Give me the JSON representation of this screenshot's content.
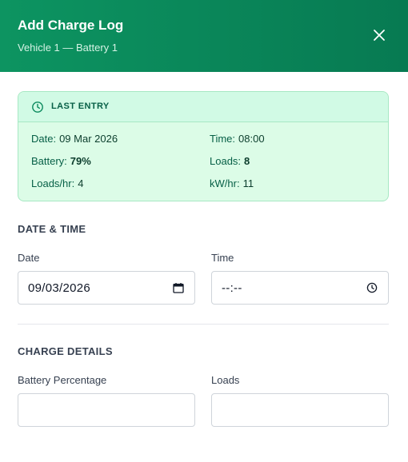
{
  "header": {
    "title": "Add Charge Log",
    "subtitle": "Vehicle 1 — Battery 1",
    "close_icon": "close-icon"
  },
  "last_entry": {
    "title": "LAST ENTRY",
    "icon": "clock-icon",
    "date_label": "Date:",
    "date_value": "09 Mar 2026",
    "time_label": "Time:",
    "time_value": "08:00",
    "battery_label": "Battery:",
    "battery_value": "79%",
    "loads_label": "Loads:",
    "loads_value": "8",
    "loads_hr_label": "Loads/hr:",
    "loads_hr_value": "4",
    "kwh_label": "kW/hr:",
    "kwh_value": "11"
  },
  "date_time": {
    "section_title": "DATE & TIME",
    "date_label": "Date",
    "date_value": "09/03/2026",
    "date_icon": "calendar-icon",
    "time_label": "Time",
    "time_value": "--:--",
    "time_icon": "clock-icon"
  },
  "charge_details": {
    "section_title": "CHARGE DETAILS",
    "battery_label": "Battery Percentage",
    "battery_value": "",
    "loads_label": "Loads",
    "loads_value": ""
  },
  "colors": {
    "header_start": "#0d9461",
    "header_end": "#077a52",
    "card_bg": "#dcfce7",
    "card_border": "#a7e8c4",
    "accent_text": "#065f46"
  }
}
